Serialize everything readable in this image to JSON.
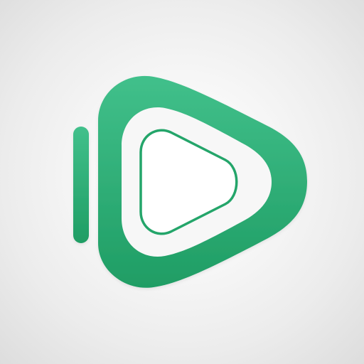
{
  "app_icon": {
    "icon_name": "play-button-logo-icon",
    "colors": {
      "green_top": "#41c08b",
      "green_bottom": "#1f9d64",
      "inner_white": "#f7f7f7",
      "play_symbol": "#ffffff",
      "background_center": "#ffffff",
      "background_edge": "#dddddd"
    }
  }
}
